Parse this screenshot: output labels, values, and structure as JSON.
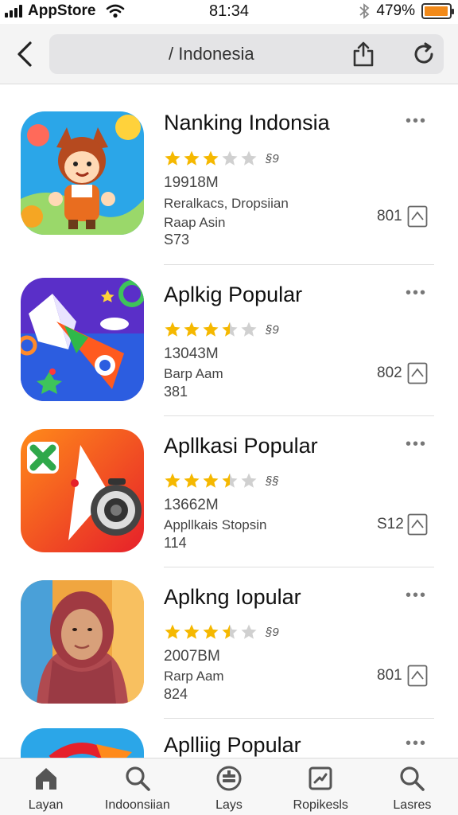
{
  "status_bar": {
    "carrier": "AppStore",
    "time": "81:34",
    "battery_percent": "479%",
    "battery_level": 0.95
  },
  "nav": {
    "url": "/ Indonesia",
    "icons": [
      "chevron-left-icon",
      "share-icon",
      "reload-icon"
    ]
  },
  "apps": [
    {
      "title": "Nanking Indonsia",
      "stars": 3,
      "rating_count": "§9",
      "size": "19918M",
      "desc_line1": "Reralkacs, Dropsiian",
      "desc_line2": "Raap Asin",
      "code": "S73",
      "price": "801"
    },
    {
      "title": "Aplkig Popular",
      "stars": 3.5,
      "rating_count": "§9",
      "size": "13043M",
      "desc_line1": "Barp Aam",
      "desc_line2": "",
      "code": "381",
      "price": "802"
    },
    {
      "title": "Apllkasi Popular",
      "stars": 3.5,
      "rating_count": "§§",
      "size": "13662M",
      "desc_line1": "Appllkais Stopsin",
      "desc_line2": "",
      "code": "114",
      "price": "S12"
    },
    {
      "title": "Aplkng Iopular",
      "stars": 3.5,
      "rating_count": "§9",
      "size": "2007BM",
      "desc_line1": "Rarp Aam",
      "desc_line2": "",
      "code": "824",
      "price": "801"
    },
    {
      "title": "Aplliig Popular"
    }
  ],
  "tabs": [
    {
      "label": "Layan",
      "icon": "home-icon"
    },
    {
      "label": "Indoonsiian",
      "icon": "search-icon"
    },
    {
      "label": "Lays",
      "icon": "stack-icon"
    },
    {
      "label": "Ropikesls",
      "icon": "apps-icon"
    },
    {
      "label": "Lasres",
      "icon": "search-icon"
    }
  ],
  "colors": {
    "star_filled": "#f5b800",
    "star_empty": "#d0d0d0",
    "battery": "#f28a1a"
  }
}
